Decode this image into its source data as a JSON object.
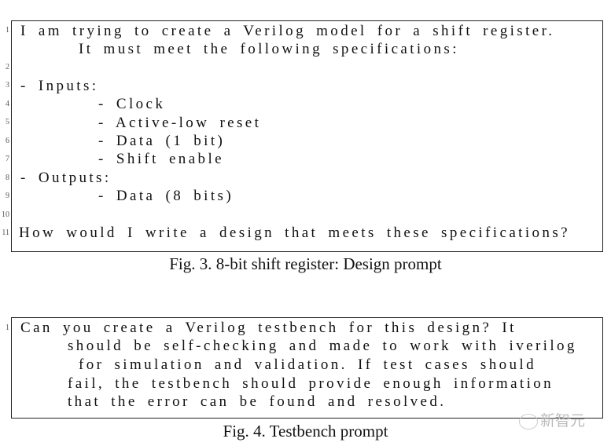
{
  "figure3": {
    "lines": [
      {
        "num": "1",
        "text": "I am trying to create a Verilog model for a shift register."
      },
      {
        "num": "",
        "text": "It must meet the following specifications:"
      },
      {
        "num": "2",
        "text": ""
      },
      {
        "num": "3",
        "text": "- Inputs:"
      },
      {
        "num": "4",
        "text": "- Clock"
      },
      {
        "num": "5",
        "text": "- Active-low reset"
      },
      {
        "num": "6",
        "text": "- Data (1 bit)"
      },
      {
        "num": "7",
        "text": "- Shift enable"
      },
      {
        "num": "8",
        "text": "- Outputs:"
      },
      {
        "num": "9",
        "text": "- Data (8 bits)"
      },
      {
        "num": "10",
        "text": ""
      },
      {
        "num": "11",
        "text": "How would I write a design that meets these specifications?"
      }
    ],
    "caption": "Fig. 3.  8-bit shift register: Design prompt"
  },
  "figure4": {
    "lines": [
      {
        "num": "1",
        "text": "Can you create a Verilog testbench for this design? It"
      },
      {
        "num": "",
        "text": "should be self-checking and made to work with iverilog"
      },
      {
        "num": "",
        "text": "for simulation and validation. If test cases should"
      },
      {
        "num": "",
        "text": "fail, the testbench should provide enough information"
      },
      {
        "num": "",
        "text": "that the error can be found and resolved."
      }
    ],
    "caption": "Fig. 4.  Testbench prompt"
  },
  "watermark": {
    "text": "新智元",
    "icon": "wechat-icon"
  }
}
